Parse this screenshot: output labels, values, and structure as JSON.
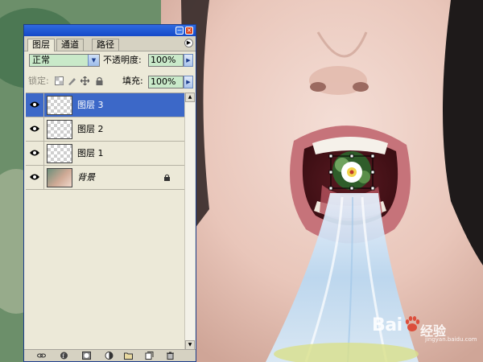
{
  "panel": {
    "tabs": [
      {
        "label": "图层",
        "active": true
      },
      {
        "label": "通道",
        "active": false
      },
      {
        "label": "路径",
        "active": false
      }
    ],
    "blend_mode": "正常",
    "opacity_label": "不透明度:",
    "opacity_value": "100%",
    "lock_label": "锁定:",
    "fill_label": "填充:",
    "fill_value": "100%",
    "layers": [
      {
        "name": "图层 3",
        "selected": true
      },
      {
        "name": "图层 2",
        "selected": false
      },
      {
        "name": "图层 1",
        "selected": false
      },
      {
        "name": "背景",
        "selected": false,
        "locked": true
      }
    ],
    "bottom_icons": [
      "link-layers-icon",
      "layer-style-icon",
      "layer-mask-icon",
      "adjustment-layer-icon",
      "new-group-icon",
      "new-layer-icon",
      "delete-layer-icon"
    ]
  },
  "watermark": {
    "text_a": "Bai",
    "text_b": "经验",
    "sub": "jingyan.baidu.com"
  },
  "colors": {
    "titlebar": "#1449c8",
    "selection": "#3c68c8",
    "panel_bg": "#ece9d8",
    "field_bg": "#c9e9c9"
  }
}
